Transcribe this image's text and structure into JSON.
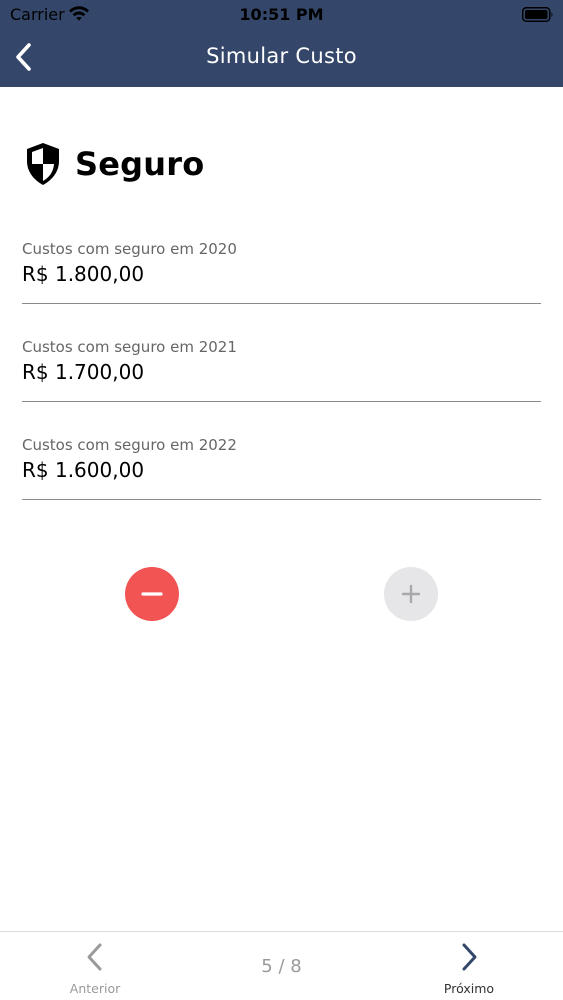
{
  "status_bar": {
    "carrier": "Carrier",
    "time": "10:51 PM",
    "wifi_icon": "wifi-icon",
    "battery_icon": "battery-icon"
  },
  "nav": {
    "title": "Simular Custo",
    "back_icon": "chevron-left-icon"
  },
  "section": {
    "title": "Seguro",
    "icon": "shield-icon"
  },
  "fields": [
    {
      "label": "Custos com seguro em 2020",
      "value": "R$ 1.800,00"
    },
    {
      "label": "Custos com seguro em 2021",
      "value": "R$ 1.700,00"
    },
    {
      "label": "Custos com seguro em 2022",
      "value": "R$ 1.600,00"
    }
  ],
  "actions": {
    "remove_icon": "minus-icon",
    "add_icon": "plus-icon"
  },
  "footer": {
    "prev_label": "Anterior",
    "next_label": "Próximo",
    "page": "5 / 8"
  },
  "colors": {
    "header": "#34476a",
    "remove": "#f25454",
    "add_disabled": "#e6e6e8"
  }
}
